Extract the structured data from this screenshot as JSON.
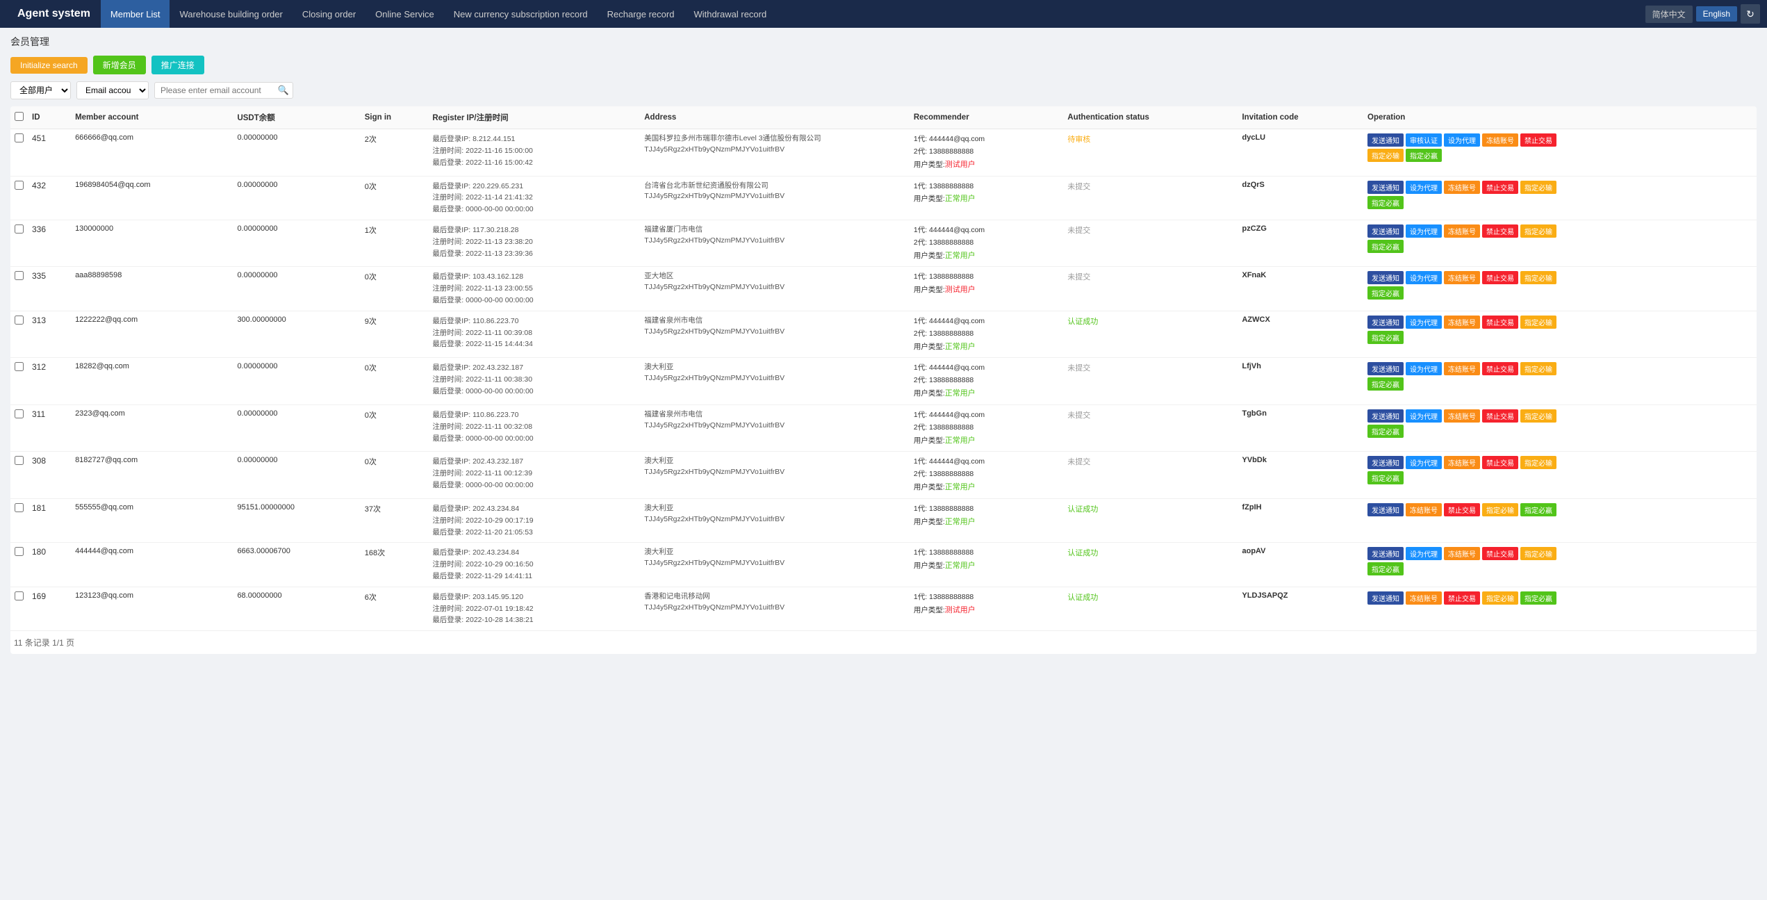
{
  "header": {
    "brand": "Agent system",
    "nav": [
      {
        "label": "Member List",
        "active": true
      },
      {
        "label": "Warehouse building order",
        "active": false
      },
      {
        "label": "Closing order",
        "active": false
      },
      {
        "label": "Online Service",
        "active": false
      },
      {
        "label": "New currency subscription record",
        "active": false
      },
      {
        "label": "Recharge record",
        "active": false
      },
      {
        "label": "Withdrawal record",
        "active": false
      }
    ],
    "lang_cn": "简体中文",
    "lang_en": "English",
    "refresh_icon": "↻"
  },
  "toolbar": {
    "section_title": "会员管理",
    "btn_init": "Initialize search",
    "btn_new": "新增会员",
    "btn_promo": "推广连接"
  },
  "filters": {
    "select1_options": [
      "全部用户"
    ],
    "select1_value": "全部用户",
    "select2_options": [
      "Email accou"
    ],
    "select2_value": "Email accou",
    "search_placeholder": "Please enter email account"
  },
  "table": {
    "headers": [
      "",
      "ID",
      "Member account",
      "USDT余额",
      "Sign in",
      "Register IP/注册时间",
      "Address",
      "Recommender",
      "Authentication status",
      "Invitation code",
      "Operation"
    ],
    "rows": [
      {
        "id": "451",
        "account": "666666@qq.com",
        "usdt": "0.00000000",
        "signin": "2次",
        "ip_info": "最后登录IP: 8.212.44.151\n注册时间: 2022-11-16 15:00:00\n最后登录: 2022-11-16 15:00:42",
        "address": "美国科罗拉多州市瑞菲尔德市Level 3通信股份有限公司\nTJJ4y5Rgz2xHTb9yQNzmPMJYVo1uitfrBV",
        "recommender": "1代: 444444@qq.com\n2代: 13888888888",
        "user_type_label": "用户类型:",
        "user_type": "测试用户",
        "user_type_class": "user-type-trial",
        "auth_status": "待审核",
        "auth_status_class": "status-pending",
        "invite_code": "dycLU",
        "ops": [
          "发送通知",
          "审核认证",
          "设为代理",
          "冻结账号",
          "禁止交易",
          "指定必输",
          "指定必赢"
        ]
      },
      {
        "id": "432",
        "account": "1968984054@qq.com",
        "usdt": "0.00000000",
        "signin": "0次",
        "ip_info": "最后登录IP: 220.229.65.231\n注册时间: 2022-11-14 21:41:32\n最后登录: 0000-00-00 00:00:00",
        "address": "台湾省台北市新世纪资通股份有限公司\nTJJ4y5Rgz2xHTb9yQNzmPMJYVo1uitfrBV",
        "recommender": "1代: 13888888888",
        "user_type_label": "用户类型:",
        "user_type": "正常用户",
        "user_type_class": "user-type-normal",
        "auth_status": "未提交",
        "auth_status_class": "status-unsubmit",
        "invite_code": "dzQrS",
        "ops": [
          "发送通知",
          "设为代理",
          "冻结账号",
          "禁止交易",
          "指定必输",
          "指定必赢"
        ]
      },
      {
        "id": "336",
        "account": "130000000",
        "usdt": "0.00000000",
        "signin": "1次",
        "ip_info": "最后登录IP: 117.30.218.28\n注册时间: 2022-11-13 23:38:20\n最后登录: 2022-11-13 23:39:36",
        "address": "福建省厦门市电信\nTJJ4y5Rgz2xHTb9yQNzmPMJYVo1uitfrBV",
        "recommender": "1代: 444444@qq.com\n2代: 13888888888",
        "user_type_label": "用户类型:",
        "user_type": "正常用户",
        "user_type_class": "user-type-normal",
        "auth_status": "未提交",
        "auth_status_class": "status-unsubmit",
        "invite_code": "pzCZG",
        "ops": [
          "发送通知",
          "设为代理",
          "冻结账号",
          "禁止交易",
          "指定必输",
          "指定必赢"
        ]
      },
      {
        "id": "335",
        "account": "aaa88898598",
        "usdt": "0.00000000",
        "signin": "0次",
        "ip_info": "最后登录IP: 103.43.162.128\n注册时间: 2022-11-13 23:00:55\n最后登录: 0000-00-00 00:00:00",
        "address": "亚大地区\nTJJ4y5Rgz2xHTb9yQNzmPMJYVo1uitfrBV",
        "recommender": "1代: 13888888888",
        "user_type_label": "用户类型:",
        "user_type": "测试用户",
        "user_type_class": "user-type-trial",
        "auth_status": "未提交",
        "auth_status_class": "status-unsubmit",
        "invite_code": "XFnaK",
        "ops": [
          "发送通知",
          "设为代理",
          "冻结账号",
          "禁止交易",
          "指定必输",
          "指定必赢"
        ]
      },
      {
        "id": "313",
        "account": "1222222@qq.com",
        "usdt": "300.00000000",
        "signin": "9次",
        "ip_info": "最后登录IP: 110.86.223.70\n注册时间: 2022-11-11 00:39:08\n最后登录: 2022-11-15 14:44:34",
        "address": "福建省泉州市电信\nTJJ4y5Rgz2xHTb9yQNzmPMJYVo1uitfrBV",
        "recommender": "1代: 444444@qq.com\n2代: 13888888888",
        "user_type_label": "用户类型:",
        "user_type": "正常用户",
        "user_type_class": "user-type-normal",
        "auth_status": "认证成功",
        "auth_status_class": "status-verified",
        "invite_code": "AZWCX",
        "ops": [
          "发送通知",
          "设为代理",
          "冻结账号",
          "禁止交易",
          "指定必输",
          "指定必赢"
        ]
      },
      {
        "id": "312",
        "account": "18282@qq.com",
        "usdt": "0.00000000",
        "signin": "0次",
        "ip_info": "最后登录IP: 202.43.232.187\n注册时间: 2022-11-11 00:38:30\n最后登录: 0000-00-00 00:00:00",
        "address": "澳大利亚\nTJJ4y5Rgz2xHTb9yQNzmPMJYVo1uitfrBV",
        "recommender": "1代: 444444@qq.com\n2代: 13888888888",
        "user_type_label": "用户类型:",
        "user_type": "正常用户",
        "user_type_class": "user-type-normal",
        "auth_status": "未提交",
        "auth_status_class": "status-unsubmit",
        "invite_code": "LfjVh",
        "ops": [
          "发送通知",
          "设为代理",
          "冻结账号",
          "禁止交易",
          "指定必输",
          "指定必赢"
        ]
      },
      {
        "id": "311",
        "account": "2323@qq.com",
        "usdt": "0.00000000",
        "signin": "0次",
        "ip_info": "最后登录IP: 110.86.223.70\n注册时间: 2022-11-11 00:32:08\n最后登录: 0000-00-00 00:00:00",
        "address": "福建省泉州市电信\nTJJ4y5Rgz2xHTb9yQNzmPMJYVo1uitfrBV",
        "recommender": "1代: 444444@qq.com\n2代: 13888888888",
        "user_type_label": "用户类型:",
        "user_type": "正常用户",
        "user_type_class": "user-type-normal",
        "auth_status": "未提交",
        "auth_status_class": "status-unsubmit",
        "invite_code": "TgbGn",
        "ops": [
          "发送通知",
          "设为代理",
          "冻结账号",
          "禁止交易",
          "指定必输",
          "指定必赢"
        ]
      },
      {
        "id": "308",
        "account": "8182727@qq.com",
        "usdt": "0.00000000",
        "signin": "0次",
        "ip_info": "最后登录IP: 202.43.232.187\n注册时间: 2022-11-11 00:12:39\n最后登录: 0000-00-00 00:00:00",
        "address": "澳大利亚\nTJJ4y5Rgz2xHTb9yQNzmPMJYVo1uitfrBV",
        "recommender": "1代: 444444@qq.com\n2代: 13888888888",
        "user_type_label": "用户类型:",
        "user_type": "正常用户",
        "user_type_class": "user-type-normal",
        "auth_status": "未提交",
        "auth_status_class": "status-unsubmit",
        "invite_code": "YVbDk",
        "ops": [
          "发送通知",
          "设为代理",
          "冻结账号",
          "禁止交易",
          "指定必输",
          "指定必赢"
        ]
      },
      {
        "id": "181",
        "account": "555555@qq.com",
        "usdt": "95151.00000000",
        "signin": "37次",
        "ip_info": "最后登录IP: 202.43.234.84\n注册时间: 2022-10-29 00:17:19\n最后登录: 2022-11-20 21:05:53",
        "address": "澳大利亚\nTJJ4y5Rgz2xHTb9yQNzmPMJYVo1uitfrBV",
        "recommender": "1代: 13888888888",
        "user_type_label": "用户类型:",
        "user_type": "正常用户",
        "user_type_class": "user-type-normal",
        "auth_status": "认证成功",
        "auth_status_class": "status-verified",
        "invite_code": "fZpIH",
        "ops": [
          "发送通知",
          "冻结账号",
          "禁止交易",
          "指定必输",
          "指定必赢"
        ]
      },
      {
        "id": "180",
        "account": "444444@qq.com",
        "usdt": "6663.00006700",
        "signin": "168次",
        "ip_info": "最后登录IP: 202.43.234.84\n注册时间: 2022-10-29 00:16:50\n最后登录: 2022-11-29 14:41:11",
        "address": "澳大利亚\nTJJ4y5Rgz2xHTb9yQNzmPMJYVo1uitfrBV",
        "recommender": "1代: 13888888888",
        "user_type_label": "用户类型:",
        "user_type": "正常用户",
        "user_type_class": "user-type-normal",
        "auth_status": "认证成功",
        "auth_status_class": "status-verified",
        "invite_code": "aopAV",
        "ops": [
          "发送通知",
          "设为代理",
          "冻结账号",
          "禁止交易",
          "指定必输",
          "指定必赢"
        ]
      },
      {
        "id": "169",
        "account": "123123@qq.com",
        "usdt": "68.00000000",
        "signin": "6次",
        "ip_info": "最后登录IP: 203.145.95.120\n注册时间: 2022-07-01 19:18:42\n最后登录: 2022-10-28 14:38:21",
        "address": "香港和记电讯移动网\nTJJ4y5Rgz2xHTb9yQNzmPMJYVo1uitfrBV",
        "recommender": "1代: 13888888888",
        "user_type_label": "用户类型:",
        "user_type": "测试用户",
        "user_type_class": "user-type-trial",
        "auth_status": "认证成功",
        "auth_status_class": "status-verified",
        "invite_code": "YLDJSAPQZ",
        "ops": [
          "发送通知",
          "冻结账号",
          "禁止交易",
          "指定必输",
          "指定必赢"
        ]
      }
    ],
    "footer": "11 条记录 1/1 页"
  },
  "op_button_styles": {
    "发送通知": "op-btn-dark",
    "审核认证": "op-btn-blue",
    "设为代理": "op-btn-blue",
    "冻结账号": "op-btn-orange",
    "禁止交易": "op-btn-red",
    "指定必输": "op-btn-yellow",
    "指定必赢": "op-btn-green"
  }
}
